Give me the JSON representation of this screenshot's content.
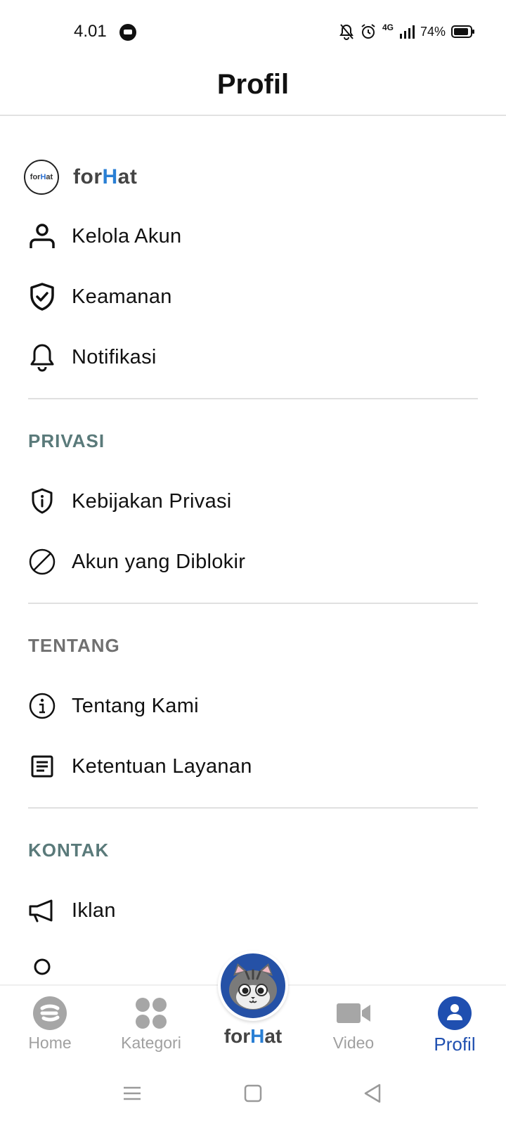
{
  "status": {
    "time": "4.01",
    "network": "4G",
    "battery": "74%"
  },
  "header": {
    "title": "Profil"
  },
  "brand": {
    "badge_prefix": "for",
    "badge_h": "H",
    "badge_suffix": "at",
    "name_prefix": "for",
    "name_h": "H",
    "name_suffix": "at"
  },
  "account_items": [
    {
      "label": "Kelola Akun",
      "icon": "user-icon"
    },
    {
      "label": "Keamanan",
      "icon": "shield-check-icon"
    },
    {
      "label": "Notifikasi",
      "icon": "bell-icon"
    }
  ],
  "sections": {
    "privacy": {
      "title": "PRIVASI",
      "color": "#5a7a7a",
      "items": [
        {
          "label": "Kebijakan Privasi",
          "icon": "shield-info-icon"
        },
        {
          "label": "Akun yang Diblokir",
          "icon": "block-icon"
        }
      ]
    },
    "about": {
      "title": "TENTANG",
      "color": "#707070",
      "items": [
        {
          "label": "Tentang Kami",
          "icon": "info-icon"
        },
        {
          "label": "Ketentuan Layanan",
          "icon": "document-icon"
        }
      ]
    },
    "contact": {
      "title": "KONTAK",
      "color": "#5a7a7a",
      "items": [
        {
          "label": "Iklan",
          "icon": "megaphone-icon"
        }
      ]
    }
  },
  "bottom_nav": {
    "home": "Home",
    "category": "Kategori",
    "center_prefix": "for",
    "center_h": "H",
    "center_suffix": "at",
    "video": "Video",
    "profile": "Profil",
    "active": "profile",
    "active_color": "#1f4fb0",
    "inactive_color": "#a0a0a0"
  }
}
